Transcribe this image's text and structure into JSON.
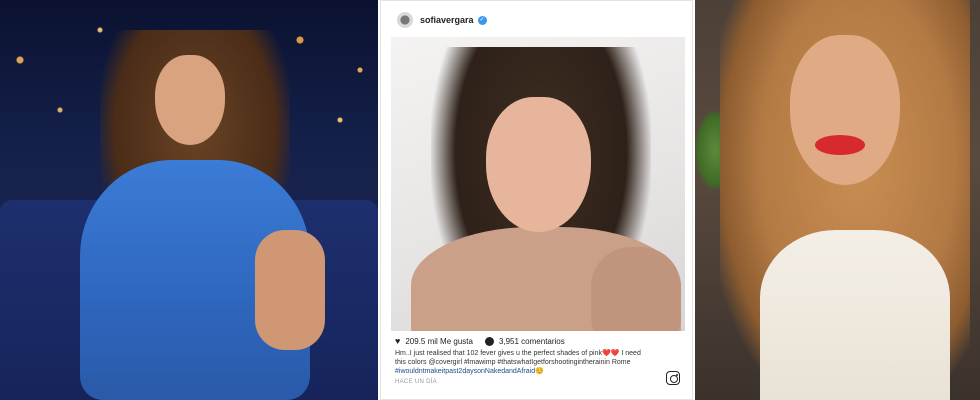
{
  "post": {
    "username": "sofiavergara",
    "likes": "209.5 mil Me gusta",
    "comments": "3,951 comentarios",
    "caption": "Hm..I just realised that 102 fever gives u the perfect shades of pink❤️❤️ I need this colors @covergirl #lmawimp #thatswhatIgetforshootingintherainin Rome",
    "hashtags_line": "#iwouldntmakeitpast2daysonNakedandAfraid☺️",
    "time": "HACE UN DÍA"
  },
  "icons": {
    "heart": "heart-icon",
    "comment": "comment-icon",
    "instagram": "instagram-icon",
    "verified": "verified-badge-icon"
  },
  "colors": {
    "dress_blue": "#3b7cd6",
    "lipstick_red": "#d82a2e",
    "instagram_link": "#1b4d8a",
    "verified_blue": "#3897f0"
  }
}
